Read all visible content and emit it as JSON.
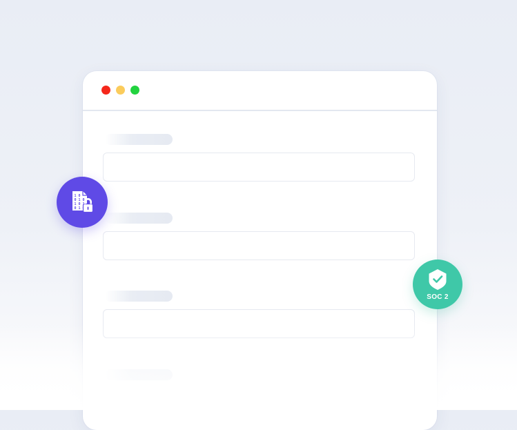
{
  "colors": {
    "window_red": "#f5271b",
    "window_yellow": "#fbcc5c",
    "window_green": "#22d33f",
    "encryption_badge": "#5f4ae6",
    "soc_badge": "#3fc8a8"
  },
  "badges": {
    "encryption": {
      "icon": "encrypted-file-lock-icon"
    },
    "soc": {
      "icon": "shield-check-icon",
      "label": "SOC 2"
    }
  },
  "form": {
    "field_count": 4
  }
}
